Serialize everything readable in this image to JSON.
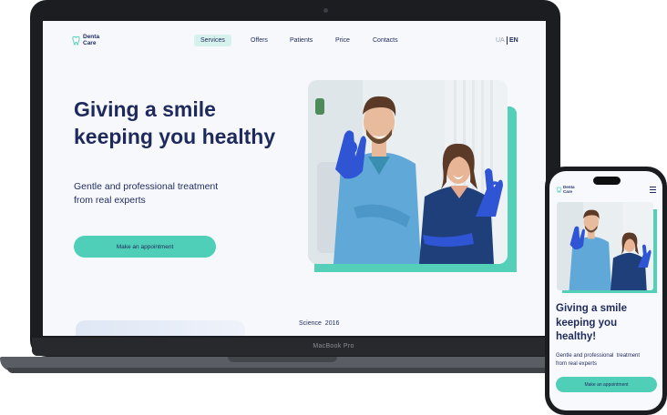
{
  "laptop": {
    "model_label": "MacBook Pro",
    "site": {
      "logo": {
        "line1": "Denta",
        "line2": "Care",
        "icon": "tooth-icon"
      },
      "nav": [
        {
          "label": "Services",
          "active": true
        },
        {
          "label": "Offers",
          "active": false
        },
        {
          "label": "Patients",
          "active": false
        },
        {
          "label": "Price",
          "active": false
        },
        {
          "label": "Contacts",
          "active": false
        }
      ],
      "languages": {
        "ua": "UA",
        "en": "EN",
        "selected": "EN"
      },
      "hero": {
        "title_line1": "Giving a smile",
        "title_line2": "keeping you healthy",
        "subtitle_line1": "Gentle and professional treatment",
        "subtitle_line2": "from real experts",
        "cta": "Make an appointment"
      },
      "below_fold": {
        "science_label": "Science",
        "science_year": "2016"
      }
    }
  },
  "phone": {
    "logo": {
      "line1": "Denta",
      "line2": "Care",
      "icon": "tooth-icon"
    },
    "menu_icon": "hamburger-menu-icon",
    "hero": {
      "title_line1": "Giving a smile",
      "title_line2": "keeping you",
      "title_line3": "healthy!",
      "subtitle_line1": "Gentle and professional  treatment",
      "subtitle_line2": "from real experts",
      "cta": "Make an appointment"
    }
  },
  "colors": {
    "brand_navy": "#1f2a5c",
    "accent_teal": "#4fcfb8",
    "nav_active_bg": "#d7f1ec",
    "device_dark": "#1c1d20"
  }
}
